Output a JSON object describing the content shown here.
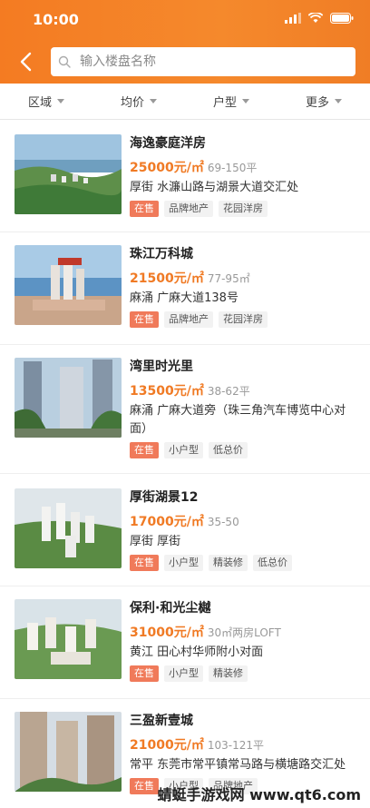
{
  "status": {
    "time": "10:00"
  },
  "search": {
    "placeholder": "输入楼盘名称"
  },
  "filters": [
    "区域",
    "均价",
    "户型",
    "更多"
  ],
  "listings": [
    {
      "name": "海逸豪庭洋房",
      "price": "25000元/㎡",
      "area": "69-150平",
      "address": "厚街 水濂山路与湖景大道交汇处",
      "status": "在售",
      "tags": [
        "品牌地产",
        "花园洋房"
      ]
    },
    {
      "name": "珠江万科城",
      "price": "21500元/㎡",
      "area": "77-95㎡",
      "address": "麻涌 广麻大道138号",
      "status": "在售",
      "tags": [
        "品牌地产",
        "花园洋房"
      ]
    },
    {
      "name": "湾里时光里",
      "price": "13500元/㎡",
      "area": "38-62平",
      "address": "麻涌 广麻大道旁（珠三角汽车博览中心对面）",
      "status": "在售",
      "tags": [
        "小户型",
        "低总价"
      ]
    },
    {
      "name": "厚街湖景12",
      "price": "17000元/㎡",
      "area": "35-50",
      "address": "厚街 厚街",
      "status": "在售",
      "tags": [
        "小户型",
        "精装修",
        "低总价"
      ]
    },
    {
      "name": "保利·和光尘樾",
      "price": "31000元/㎡",
      "area": "30㎡两房LOFT",
      "address": "黄江 田心村华师附小对面",
      "status": "在售",
      "tags": [
        "小户型",
        "精装修"
      ]
    },
    {
      "name": "三盈新壹城",
      "price": "21000元/㎡",
      "area": "103-121平",
      "address": "常平 东莞市常平镇常马路与横塘路交汇处",
      "status": "在售",
      "tags": [
        "小户型",
        "品牌地产"
      ]
    }
  ],
  "watermark": "蜻蜓手游戏网 www.qt6.com",
  "colors": {
    "accent": "#f07a24",
    "header": "#f5892c",
    "sale_tag": "#f07a5a"
  }
}
